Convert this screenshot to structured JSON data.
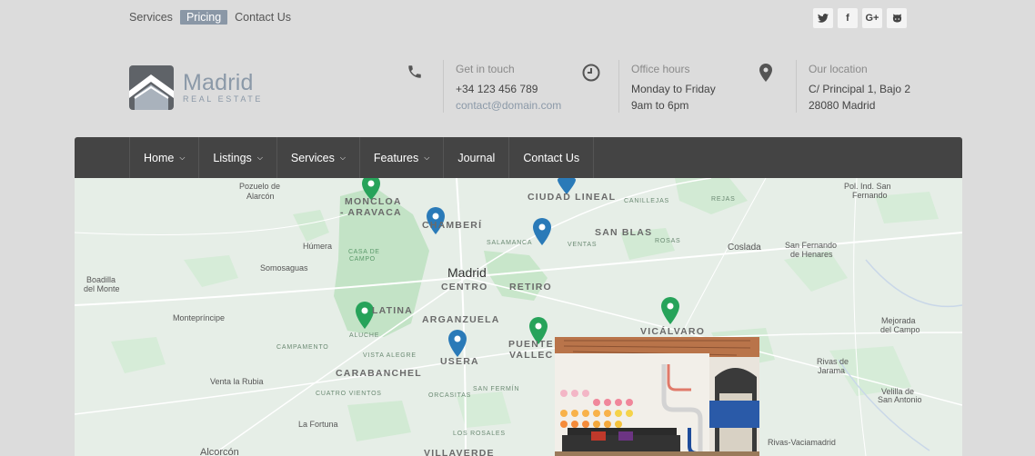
{
  "topbar": {
    "links": [
      "Services",
      "Pricing",
      "Contact Us"
    ],
    "active_link": "Pricing",
    "social": [
      "twitter-icon",
      "facebook-icon",
      "google-plus-icon",
      "github-icon"
    ]
  },
  "brand": {
    "title": "Madrid",
    "subtitle": "REAL ESTATE"
  },
  "contact": {
    "label": "Get in touch",
    "phone": "+34 123 456 789",
    "email": "contact@domain.com"
  },
  "hours": {
    "label": "Office hours",
    "line1": "Monday to Friday",
    "line2": "9am to 6pm"
  },
  "location": {
    "label": "Our location",
    "line1": "C/ Principal 1, Bajo 2",
    "line2": "28080 Madrid"
  },
  "nav": {
    "items": [
      {
        "label": "Home",
        "dropdown": true
      },
      {
        "label": "Listings",
        "dropdown": true
      },
      {
        "label": "Services",
        "dropdown": true
      },
      {
        "label": "Features",
        "dropdown": true
      },
      {
        "label": "Journal",
        "dropdown": false
      },
      {
        "label": "Contact Us",
        "dropdown": false
      }
    ]
  },
  "map": {
    "labels": {
      "pozuelo": "Pozuelo de",
      "alarcon": "Alarcón",
      "moncloa": "MONCLOA",
      "aravaca": "- ARAVACA",
      "ciudad_lineal": "CIUDAD LINEAL",
      "canillejas": "CANILLEJAS",
      "rejas": "REJAS",
      "pol_ind": "Pol. Ind. San",
      "fernando": "Fernando",
      "chamberi": "CHAMBERÍ",
      "san_blas": "SAN BLAS",
      "salamanca": "SALAMANCA",
      "ventas": "VENTAS",
      "rosas": "ROSAS",
      "coslada": "Coslada",
      "san_fernando": "San Fernando",
      "de_henares": "de Henares",
      "humera": "Húmera",
      "casa_de": "CASA DE",
      "campo": "CAMPO",
      "somosaguas": "Somosaguas",
      "madrid": "Madrid",
      "centro": "CENTRO",
      "retiro": "RETIRO",
      "boadilla": "Boadilla",
      "del_monte": "del Monte",
      "montepríncipe": "Montepríncipe",
      "latina": "LATINA",
      "arganzuela": "ARGANZUELA",
      "puente": "PUENTE",
      "vallecas": "VALLEC",
      "vicalvaro": "VICÁLVARO",
      "mejorada": "Mejorada",
      "del_campo": "del Campo",
      "aluche": "ALUCHE",
      "campamento": "CAMPAMENTO",
      "vista_alegre": "VISTA ALEGRE",
      "usera": "USERA",
      "carabanchel": "CARABANCHEL",
      "rivas": "Rivas de",
      "jarama": "Jarama",
      "venta_rubia": "Venta la Rubia",
      "cuatro_vientos": "CUATRO VIENTOS",
      "orcasitas": "ORCASITAS",
      "san_fermin": "SAN FERMÍN",
      "velilla": "Velilla de",
      "san_antonio": "San Antonio",
      "la_fortuna": "La Fortuna",
      "los_rosales": "LOS ROSALES",
      "rivas_vacia": "Rivas-Vaciamadrid",
      "alcorcon": "Alcorcón",
      "villaverde": "VILLAVERDE"
    },
    "markers": {
      "green": 4,
      "blue": 4
    }
  },
  "colors": {
    "accent": "#8a97a6",
    "nav_bg": "#444444",
    "marker_green": "#27a35a",
    "marker_blue": "#2a7ab8"
  }
}
